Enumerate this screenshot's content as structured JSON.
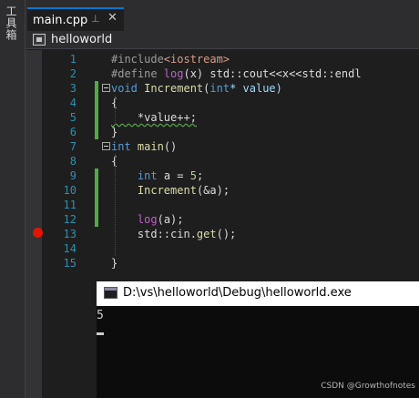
{
  "toolbox": {
    "label": "工具箱"
  },
  "tab": {
    "title": "main.cpp",
    "pin_glyph": "⊥",
    "close_glyph": "✕"
  },
  "nav": {
    "project": "helloworld"
  },
  "colors": {
    "keyword": "#569cd6",
    "preprocessor": "#9b9b9b",
    "function": "#dcdcaa",
    "number": "#b5cea8",
    "text": "#dcdcdc",
    "line_number": "#2b91af",
    "change_bar": "#57a64a",
    "breakpoint": "#e51400",
    "macro": "#bd63c5"
  },
  "editor": {
    "lines": [
      {
        "n": "1",
        "parts": [
          {
            "t": "#include",
            "c": "#9b9b9b"
          },
          {
            "t": "<iostream>",
            "c": "#d69d85"
          }
        ]
      },
      {
        "n": "2",
        "parts": [
          {
            "t": "#define ",
            "c": "#9b9b9b"
          },
          {
            "t": "log",
            "c": "#bd63c5"
          },
          {
            "t": "(x) std::cout<<x<<std::endl",
            "c": "#dcdcdc"
          }
        ]
      },
      {
        "n": "3",
        "parts": [
          {
            "t": "void ",
            "c": "#569cd6"
          },
          {
            "t": "Increment",
            "c": "#dcdcaa"
          },
          {
            "t": "(",
            "c": "#dcdcdc"
          },
          {
            "t": "int",
            "c": "#569cd6"
          },
          {
            "t": "* value)",
            "c": "#9cdcfe"
          }
        ]
      },
      {
        "n": "4",
        "parts": [
          {
            "t": "{",
            "c": "#dcdcdc"
          }
        ]
      },
      {
        "n": "5",
        "parts": [
          {
            "t": "    *value++;",
            "c": "#dcdcdc",
            "squiggle": true
          }
        ]
      },
      {
        "n": "6",
        "parts": [
          {
            "t": "}",
            "c": "#dcdcdc"
          }
        ]
      },
      {
        "n": "7",
        "parts": [
          {
            "t": "int ",
            "c": "#569cd6"
          },
          {
            "t": "main",
            "c": "#dcdcaa"
          },
          {
            "t": "()",
            "c": "#dcdcdc"
          }
        ]
      },
      {
        "n": "8",
        "parts": [
          {
            "t": "{",
            "c": "#dcdcdc"
          }
        ]
      },
      {
        "n": "9",
        "parts": [
          {
            "t": "    ",
            "c": "#dcdcdc"
          },
          {
            "t": "int ",
            "c": "#569cd6"
          },
          {
            "t": "a = ",
            "c": "#dcdcdc"
          },
          {
            "t": "5",
            "c": "#b5cea8"
          },
          {
            "t": ";",
            "c": "#dcdcdc"
          }
        ]
      },
      {
        "n": "10",
        "parts": [
          {
            "t": "    ",
            "c": "#dcdcdc"
          },
          {
            "t": "Increment",
            "c": "#dcdcaa"
          },
          {
            "t": "(&a);",
            "c": "#dcdcdc"
          }
        ]
      },
      {
        "n": "11",
        "parts": [
          {
            "t": "",
            "c": "#dcdcdc"
          }
        ]
      },
      {
        "n": "12",
        "parts": [
          {
            "t": "    ",
            "c": "#dcdcdc"
          },
          {
            "t": "log",
            "c": "#bd63c5"
          },
          {
            "t": "(a);",
            "c": "#dcdcdc"
          }
        ]
      },
      {
        "n": "13",
        "parts": [
          {
            "t": "    std::cin.",
            "c": "#dcdcdc"
          },
          {
            "t": "get",
            "c": "#dcdcaa"
          },
          {
            "t": "();",
            "c": "#dcdcdc"
          }
        ]
      },
      {
        "n": "14",
        "parts": [
          {
            "t": "",
            "c": "#dcdcdc"
          }
        ]
      },
      {
        "n": "15",
        "parts": [
          {
            "t": "}",
            "c": "#dcdcdc"
          }
        ]
      }
    ]
  },
  "console": {
    "title": "D:\\vs\\helloworld\\Debug\\helloworld.exe",
    "output": "5"
  },
  "watermark": "CSDN @Growthofnotes"
}
